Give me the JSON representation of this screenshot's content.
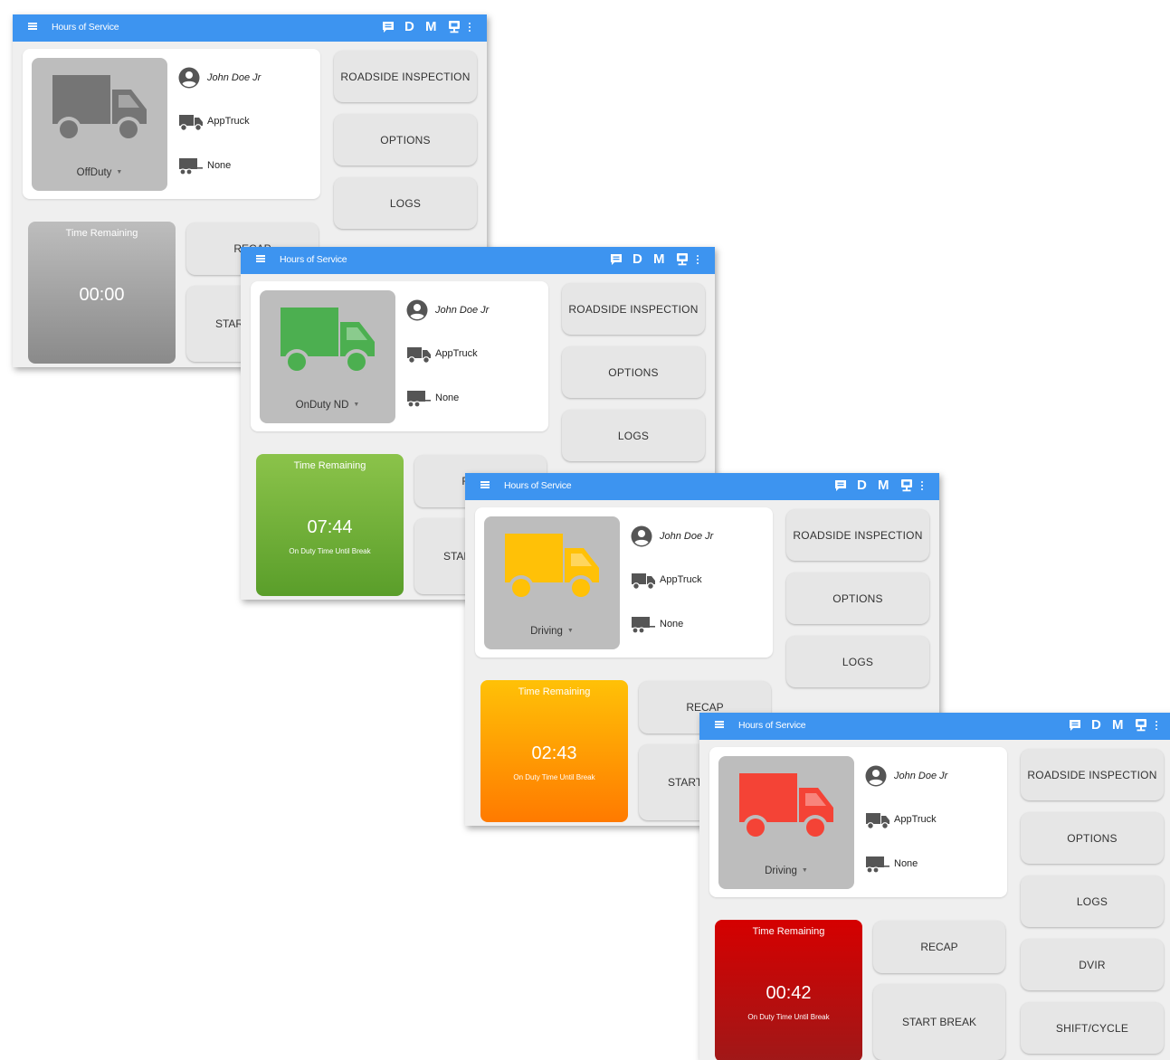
{
  "screens": [
    {
      "title": "Hours of Service",
      "toolbar": {
        "d_label": "D",
        "m_label": "M"
      },
      "status": {
        "label": "OffDuty",
        "truck_color": "#757575"
      },
      "driver": "John Doe Jr",
      "vehicle": "AppTruck",
      "trailer": "None",
      "buttons": {
        "roadside": "ROADSIDE INSPECTION",
        "options": "OPTIONS",
        "logs": "LOGS",
        "recap": "RECAP",
        "start_break": "START BREAK"
      },
      "time": {
        "title": "Time Remaining",
        "value": "00:00",
        "subtitle": "",
        "gradient_top": "#bdbdbd",
        "gradient_bottom": "#8a8a8a"
      }
    },
    {
      "title": "Hours of Service",
      "toolbar": {
        "d_label": "D",
        "m_label": "M"
      },
      "status": {
        "label": "OnDuty ND",
        "truck_color": "#4caf50"
      },
      "driver": "John Doe Jr",
      "vehicle": "AppTruck",
      "trailer": "None",
      "buttons": {
        "roadside": "ROADSIDE INSPECTION",
        "options": "OPTIONS",
        "logs": "LOGS",
        "recap": "RECAP",
        "start_break": "START BREAK"
      },
      "time": {
        "title": "Time Remaining",
        "value": "07:44",
        "subtitle": "On Duty Time Until Break",
        "gradient_top": "#8bc34a",
        "gradient_bottom": "#5a9e2a"
      }
    },
    {
      "title": "Hours of Service",
      "toolbar": {
        "d_label": "D",
        "m_label": "M"
      },
      "status": {
        "label": "Driving",
        "truck_color": "#ffc107"
      },
      "driver": "John Doe Jr",
      "vehicle": "AppTruck",
      "trailer": "None",
      "buttons": {
        "roadside": "ROADSIDE INSPECTION",
        "options": "OPTIONS",
        "logs": "LOGS",
        "recap": "RECAP",
        "start_break": "START BREAK"
      },
      "time": {
        "title": "Time Remaining",
        "value": "02:43",
        "subtitle": "On Duty Time Until Break",
        "gradient_top": "#ffc107",
        "gradient_bottom": "#ff7a00"
      }
    },
    {
      "title": "Hours of Service",
      "toolbar": {
        "d_label": "D",
        "m_label": "M"
      },
      "status": {
        "label": "Driving",
        "truck_color": "#f44336"
      },
      "driver": "John Doe Jr",
      "vehicle": "AppTruck",
      "trailer": "None",
      "buttons": {
        "roadside": "ROADSIDE INSPECTION",
        "options": "OPTIONS",
        "logs": "LOGS",
        "recap": "RECAP",
        "start_break": "START BREAK",
        "dvir": "DVIR",
        "shift_cycle": "SHIFT/CYCLE"
      },
      "time": {
        "title": "Time Remaining",
        "value": "00:42",
        "subtitle": "On Duty Time Until Break",
        "gradient_top": "#d50000",
        "gradient_bottom": "#a01818"
      }
    }
  ]
}
